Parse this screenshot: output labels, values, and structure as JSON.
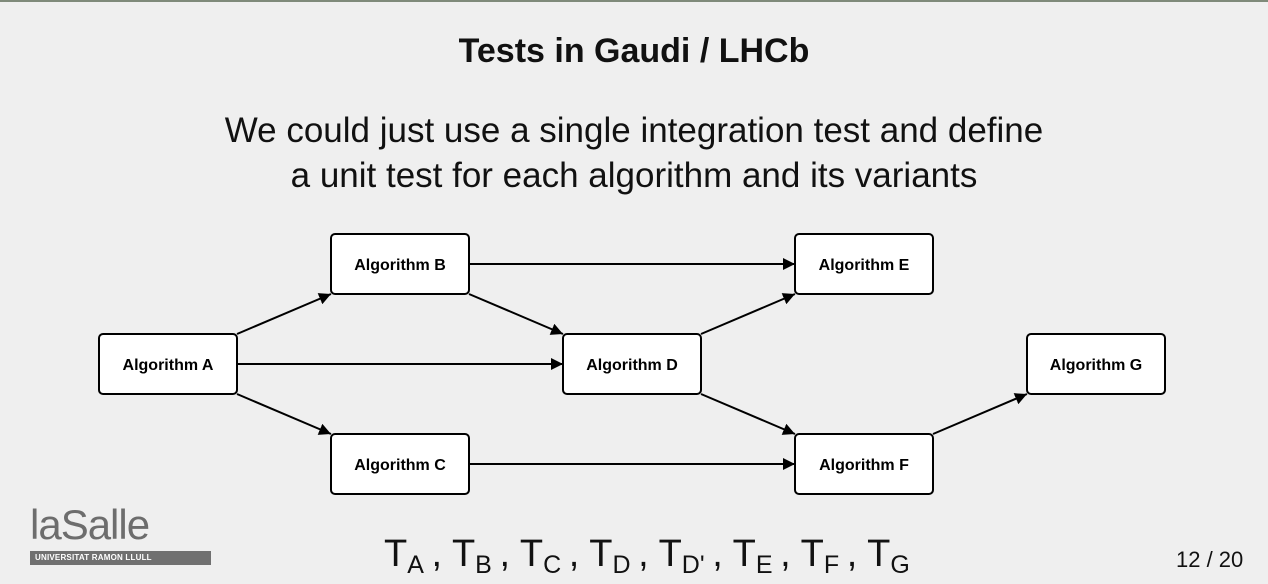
{
  "slide": {
    "title": "Tests in Gaudi / LHCb",
    "subtitle_lines": [
      "We could just use a single integration test and define",
      "a unit test for each algorithm and its variants"
    ],
    "page_number": "12 / 20"
  },
  "diagram": {
    "nodes": [
      {
        "id": "A",
        "label": "Algorithm A"
      },
      {
        "id": "B",
        "label": "Algorithm B"
      },
      {
        "id": "C",
        "label": "Algorithm C"
      },
      {
        "id": "D",
        "label": "Algorithm D"
      },
      {
        "id": "E",
        "label": "Algorithm E"
      },
      {
        "id": "F",
        "label": "Algorithm F"
      },
      {
        "id": "G",
        "label": "Algorithm G"
      }
    ],
    "edges": [
      {
        "from": "A",
        "to": "B"
      },
      {
        "from": "A",
        "to": "D"
      },
      {
        "from": "A",
        "to": "C"
      },
      {
        "from": "B",
        "to": "E"
      },
      {
        "from": "B",
        "to": "D"
      },
      {
        "from": "C",
        "to": "F"
      },
      {
        "from": "D",
        "to": "E"
      },
      {
        "from": "D",
        "to": "F"
      },
      {
        "from": "F",
        "to": "G"
      }
    ]
  },
  "formula": {
    "terms": [
      {
        "base": "T",
        "sub": "A",
        "sep": ", "
      },
      {
        "base": "T",
        "sub": "B",
        "sep": ", "
      },
      {
        "base": "T",
        "sub": "C",
        "sep": ", "
      },
      {
        "base": "T",
        "sub": "D",
        "sep": ", "
      },
      {
        "base": "T",
        "sub": "D'",
        "sep": ", "
      },
      {
        "base": "T",
        "sub": "E",
        "sep": ", "
      },
      {
        "base": "T",
        "sub": "F",
        "sep": ", "
      },
      {
        "base": "T",
        "sub": "G",
        "sep": ""
      }
    ]
  },
  "logo": {
    "wordmark": "laSalle",
    "tagline": "UNIVERSITAT RAMON LLULL"
  }
}
